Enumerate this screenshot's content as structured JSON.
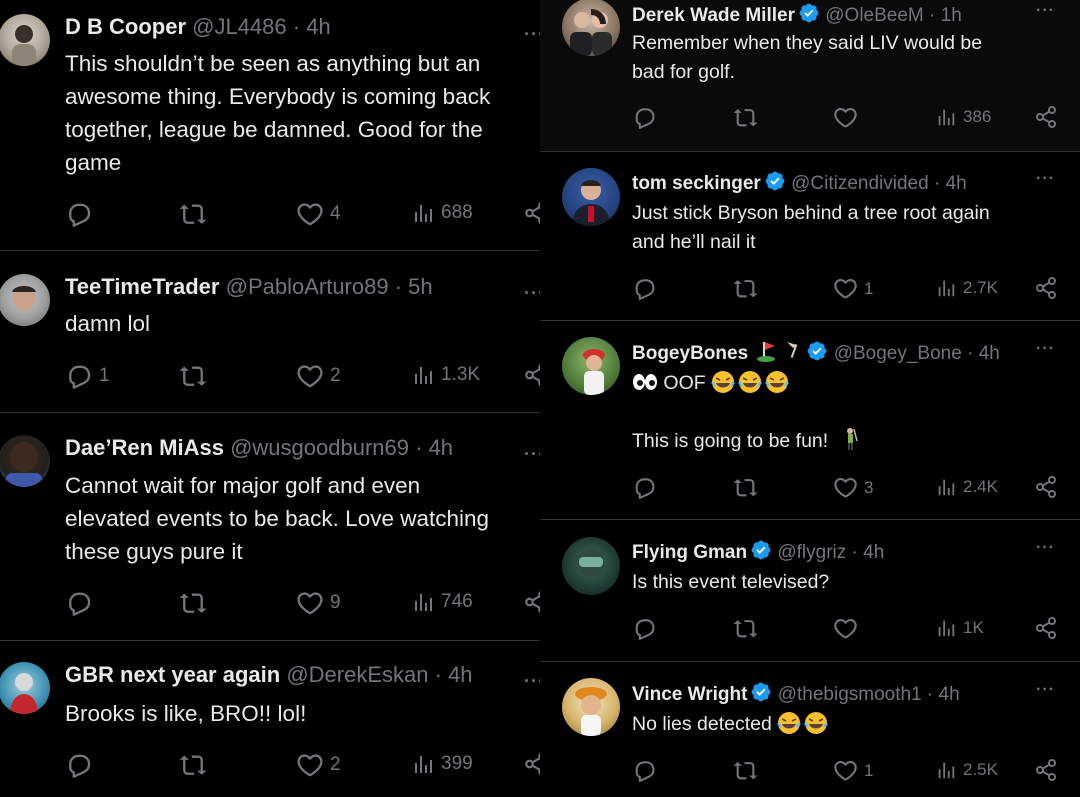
{
  "left": {
    "tweets": [
      {
        "name": "D B Cooper",
        "handle": "@JL4486",
        "time": "4h",
        "lines": [
          "This shouldn’t be seen as anything but an",
          "awesome thing. Everybody is coming back",
          "together, league be damned. Good for the",
          "game"
        ],
        "replies": "",
        "retweets": "",
        "likes": "4",
        "views": "688"
      },
      {
        "name": "TeeTimeTrader",
        "handle": "@PabloArturo89",
        "time": "5h",
        "lines": [
          "damn lol"
        ],
        "replies": "1",
        "retweets": "",
        "likes": "2",
        "views": "1.3K"
      },
      {
        "name": "Dae’Ren MiAss",
        "handle": "@wusgoodburn69",
        "time": "4h",
        "lines": [
          "Cannot wait for major golf and even",
          "elevated events to be back. Love watching",
          "these guys pure it"
        ],
        "replies": "",
        "retweets": "",
        "likes": "9",
        "views": "746"
      },
      {
        "name": "GBR next year again",
        "handle": "@DerekEskan",
        "time": "4h",
        "lines": [
          "Brooks is like, BRO!! lol!"
        ],
        "replies": "",
        "retweets": "",
        "likes": "2",
        "views": "399"
      }
    ]
  },
  "right": {
    "tweets": [
      {
        "name": "Derek Wade Miller",
        "handle": "@OleBeeM",
        "time": "1h",
        "lines": [
          "Remember when they said LIV would be",
          "bad for golf."
        ],
        "replies": "",
        "retweets": "",
        "likes": "",
        "views": "386"
      },
      {
        "name": "tom seckinger",
        "handle": "@Citizendivided",
        "time": "4h",
        "lines": [
          "Just stick Bryson behind a tree root again",
          "and he’ll nail it"
        ],
        "replies": "",
        "retweets": "",
        "likes": "1",
        "views": "2.7K"
      },
      {
        "name": "BogeyBones",
        "handle": "@Bogey_Bone",
        "time": "4h",
        "line1": "OOF",
        "line2": "This is going to be fun!",
        "replies": "",
        "retweets": "",
        "likes": "3",
        "views": "2.4K"
      },
      {
        "name": "Flying Gman",
        "handle": "@flygriz",
        "time": "4h",
        "lines": [
          "Is this event televised?"
        ],
        "replies": "",
        "retweets": "",
        "likes": "",
        "views": "1K"
      },
      {
        "name": "Vince Wright",
        "handle": "@thebigsmooth1",
        "time": "4h",
        "text": "No lies detected",
        "replies": "",
        "retweets": "",
        "likes": "1",
        "views": "2.5K"
      }
    ]
  },
  "common": {
    "dot": "·",
    "more": "···"
  },
  "colors": {
    "background": "#000000",
    "text": "#e7e9ea",
    "muted": "#71767b",
    "divider": "#2f3336",
    "verified": "#1d9bf0"
  },
  "icons": [
    "reply-icon",
    "retweet-icon",
    "like-icon",
    "views-icon",
    "share-icon",
    "verified-badge-icon",
    "more-icon"
  ]
}
